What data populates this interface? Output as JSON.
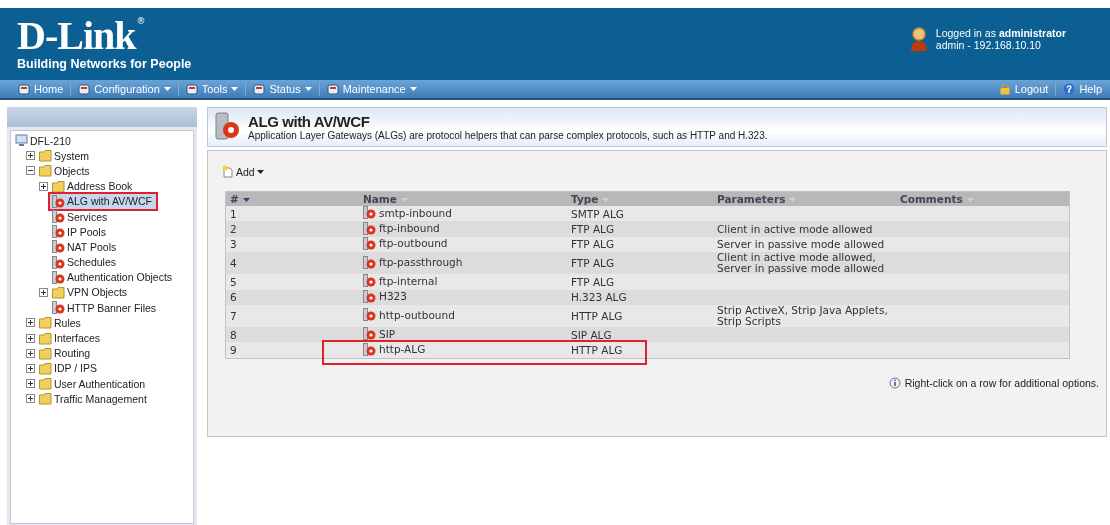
{
  "header": {
    "logo": "D-Link",
    "registered_mark": "®",
    "tagline": "Building Networks for People",
    "login_prefix": "Logged in as ",
    "login_user": "administrator",
    "login_detail": "admin - 192.168.10.10"
  },
  "nav": {
    "items": [
      {
        "label": "Home",
        "has_menu": false
      },
      {
        "label": "Configuration",
        "has_menu": true
      },
      {
        "label": "Tools",
        "has_menu": true
      },
      {
        "label": "Status",
        "has_menu": true
      },
      {
        "label": "Maintenance",
        "has_menu": true
      }
    ],
    "right_items": [
      {
        "label": "Logout",
        "kind": "logout"
      },
      {
        "label": "Help",
        "kind": "help"
      }
    ]
  },
  "sidebar": {
    "tree": [
      {
        "label": "DFL-210",
        "selected": false,
        "children": [
          {
            "label": "System",
            "selected": false,
            "expanded": false
          },
          {
            "label": "Objects",
            "selected": false,
            "expanded": true,
            "children": [
              {
                "label": "Address Book",
                "selected": false,
                "expanded": false
              },
              {
                "label": "ALG with AV/WCF",
                "selected": true,
                "annotated": true
              },
              {
                "label": "Services",
                "selected": false
              },
              {
                "label": "IP Pools",
                "selected": false
              },
              {
                "label": "NAT Pools",
                "selected": false
              },
              {
                "label": "Schedules",
                "selected": false
              },
              {
                "label": "Authentication Objects",
                "selected": false
              },
              {
                "label": "VPN Objects",
                "selected": false,
                "expanded": false
              },
              {
                "label": "HTTP Banner Files",
                "selected": false
              }
            ]
          },
          {
            "label": "Rules",
            "selected": false,
            "expanded": false
          },
          {
            "label": "Interfaces",
            "selected": false,
            "expanded": false
          },
          {
            "label": "Routing",
            "selected": false,
            "expanded": false
          },
          {
            "label": "IDP / IPS",
            "selected": false,
            "expanded": false
          },
          {
            "label": "User Authentication",
            "selected": false,
            "expanded": false
          },
          {
            "label": "Traffic Management",
            "selected": false,
            "expanded": false
          }
        ]
      }
    ]
  },
  "page": {
    "title": "ALG with AV/WCF",
    "description": "Application Layer Gateways (ALGs) are protocol helpers that can parse complex protocols, such as HTTP and H.323.",
    "add_button": "Add",
    "hint": "Right-click on a row for additional options."
  },
  "table": {
    "columns": [
      {
        "label": "#",
        "sorted": true
      },
      {
        "label": "Name",
        "sorted": false
      },
      {
        "label": "Type",
        "sorted": false
      },
      {
        "label": "Parameters",
        "sorted": false
      },
      {
        "label": "Comments",
        "sorted": false
      }
    ],
    "rows": [
      {
        "number": "1",
        "name": "smtp-inbound",
        "type": "SMTP ALG",
        "parameters": [],
        "annotated": false
      },
      {
        "number": "2",
        "name": "ftp-inbound",
        "type": "FTP ALG",
        "parameters": [
          "Client in active mode allowed"
        ],
        "annotated": false
      },
      {
        "number": "3",
        "name": "ftp-outbound",
        "type": "FTP ALG",
        "parameters": [
          "Server in passive mode allowed"
        ],
        "annotated": false
      },
      {
        "number": "4",
        "name": "ftp-passthrough",
        "type": "FTP ALG",
        "parameters": [
          "Client in active mode allowed,",
          "Server in passive mode allowed"
        ],
        "annotated": false
      },
      {
        "number": "5",
        "name": "ftp-internal",
        "type": "FTP ALG",
        "parameters": [],
        "annotated": false
      },
      {
        "number": "6",
        "name": "H323",
        "type": "H.323 ALG",
        "parameters": [],
        "annotated": false
      },
      {
        "number": "7",
        "name": "http-outbound",
        "type": "HTTP ALG",
        "parameters": [
          "Strip ActiveX, Strip Java Applets,",
          "Strip Scripts"
        ],
        "annotated": false
      },
      {
        "number": "8",
        "name": "SIP",
        "type": "SIP ALG",
        "parameters": [],
        "annotated": false
      },
      {
        "number": "9",
        "name": "http-ALG",
        "type": "HTTP ALG",
        "parameters": [],
        "annotated": true
      }
    ]
  }
}
